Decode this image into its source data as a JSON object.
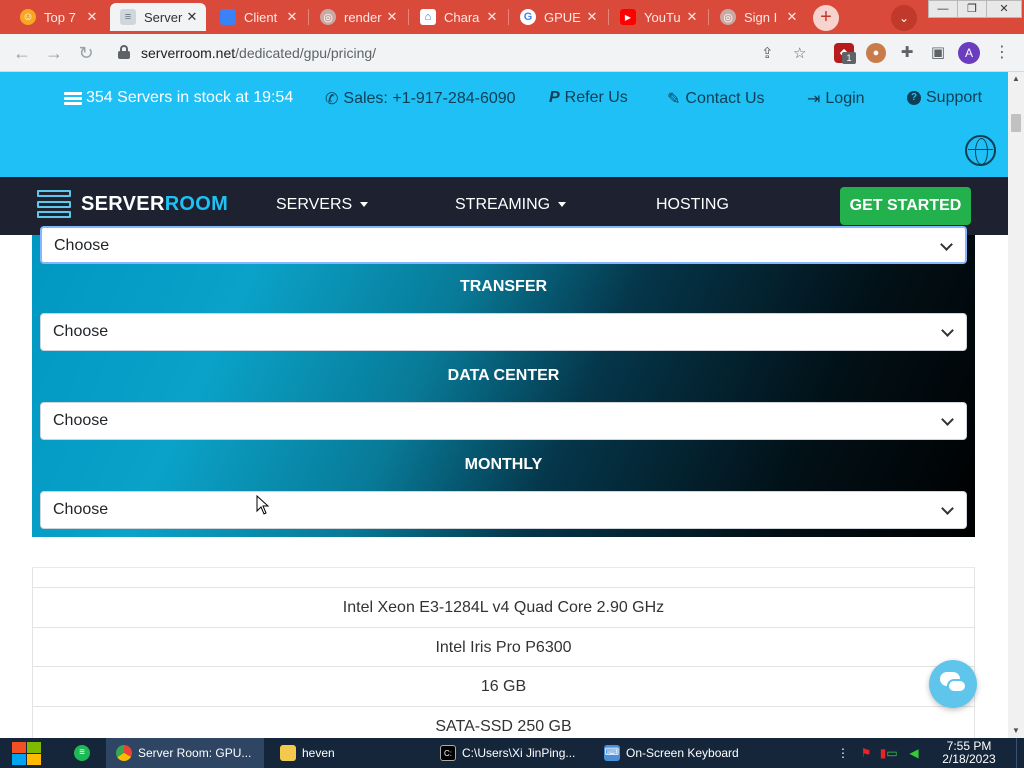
{
  "browser": {
    "tabs": [
      {
        "title": "Top 7",
        "favicon_color": "#f7a823",
        "favicon_glyph": "☺",
        "active": false
      },
      {
        "title": "Server",
        "favicon_color": "#9aa4ad",
        "favicon_glyph": "≡",
        "active": true
      },
      {
        "title": "Client",
        "favicon_color": "#3b82f6",
        "favicon_glyph": "",
        "active": false
      },
      {
        "title": "render",
        "favicon_color": "#b8a8a8",
        "favicon_glyph": "◎",
        "active": false
      },
      {
        "title": "Chara",
        "favicon_color": "#2f6db5",
        "favicon_glyph": "⌂",
        "active": false
      },
      {
        "title": "GPUE",
        "favicon_color": "#ffffff",
        "favicon_glyph": "G",
        "active": false
      },
      {
        "title": "YouTu",
        "favicon_color": "#ff0000",
        "favicon_glyph": "▶",
        "active": false
      },
      {
        "title": "Sign I",
        "favicon_color": "#b8a8a8",
        "favicon_glyph": "◎",
        "active": false
      }
    ],
    "new_tab_glyph": "+",
    "tab_search_glyph": "⌄",
    "window_controls": {
      "minimize": "—",
      "restore": "❐",
      "close": "✕"
    },
    "url_host": "serverroom.net",
    "url_path": "/dedicated/gpu/pricing/",
    "extension_badge": "1",
    "profile_initial": "A"
  },
  "topbar": {
    "stock_text": "354 Servers in stock at 19:54",
    "sales": "Sales: +1-917-284-6090",
    "refer": "Refer Us",
    "contact": "Contact Us",
    "login": "Login",
    "support": "Support"
  },
  "nav": {
    "logo_part1": "SERVER",
    "logo_part2": "ROOM",
    "servers": "SERVERS",
    "streaming": "STREAMING",
    "hosting": "HOSTING",
    "cta": "GET STARTED"
  },
  "filters": {
    "top_select": "Choose",
    "transfer_label": "TRANSFER",
    "transfer_value": "Choose",
    "datacenter_label": "DATA CENTER",
    "datacenter_value": "Choose",
    "monthly_label": "MONTHLY",
    "monthly_value": "Choose"
  },
  "specs": {
    "rows": [
      "Intel Xeon E3-1284L v4 Quad Core 2.90 GHz",
      "Intel Iris Pro P6300",
      "16 GB",
      "SATA-SSD 250 GB"
    ]
  },
  "taskbar": {
    "apps": [
      {
        "label": "Server Room: GPU...",
        "active": true
      },
      {
        "label": "heven",
        "active": false
      },
      {
        "label": "C:\\Users\\Xi JinPing...",
        "active": false
      },
      {
        "label": "On-Screen Keyboard",
        "active": false
      }
    ],
    "time": "7:55 PM",
    "date": "2/18/2023"
  },
  "colors": {
    "tabstrip": "#d94a3a",
    "topbar": "#1ec0f5",
    "nav": "#1d2130",
    "cta": "#22b14c",
    "chat": "#5fc5ea"
  }
}
